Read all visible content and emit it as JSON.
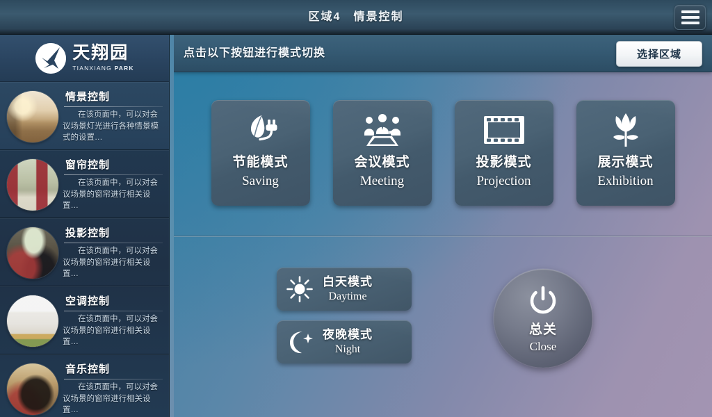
{
  "topbar": {
    "title": "区域4　情景控制",
    "menu_icon": "hamburger-menu-icon"
  },
  "sidebar": {
    "brand": {
      "logo_icon": "tianxiang-park-swoosh-logo",
      "name_cn": "天翔园",
      "name_en_1": "TIANXIANG ",
      "name_en_2": "PARK"
    },
    "items": [
      {
        "title": "情景控制",
        "desc": "在该页面中，可以对会议场景灯光进行各种情景模式的设置…",
        "thumb": "living-room-photo",
        "active": true
      },
      {
        "title": "窗帘控制",
        "desc": "在该页面中，可以对会议场景的窗帘进行相关设置…",
        "thumb": "curtain-room-photo",
        "active": false
      },
      {
        "title": "投影控制",
        "desc": "在该页面中，可以对会议场景的窗帘进行相关设置…",
        "thumb": "projector-viewers-photo",
        "active": false
      },
      {
        "title": "空调控制",
        "desc": "在该页面中，可以对会议场景的窗帘进行相关设置…",
        "thumb": "air-conditioner-photo",
        "active": false
      },
      {
        "title": "音乐控制",
        "desc": "在该页面中，可以对会议场景的窗帘进行相关设置…",
        "thumb": "headphones-listener-photo",
        "active": false
      }
    ]
  },
  "main": {
    "toolbar": {
      "hint": "点击以下按钮进行模式切换",
      "zone_button": "选择区域"
    },
    "modes": [
      {
        "cn": "节能模式",
        "en": "Saving",
        "icon": "leaf-plug-icon"
      },
      {
        "cn": "会议模式",
        "en": "Meeting",
        "icon": "meeting-people-table-icon"
      },
      {
        "cn": "投影模式",
        "en": "Projection",
        "icon": "film-strip-icon"
      },
      {
        "cn": "展示模式",
        "en": "Exhibition",
        "icon": "tulip-flower-icon"
      }
    ],
    "time_modes": [
      {
        "cn": "白天模式",
        "en": "Daytime",
        "icon": "sun-icon"
      },
      {
        "cn": "夜晚模式",
        "en": "Night",
        "icon": "moon-star-icon"
      }
    ],
    "power": {
      "cn": "总关",
      "en": "Close",
      "icon": "power-icon"
    }
  },
  "colors": {
    "topbar": "#34536a",
    "sidebar": "#223a52",
    "card": "#4a6274",
    "accent_left": "#3f80a5",
    "accent_right": "#9e92b0",
    "zone_button": "#ffffff"
  }
}
